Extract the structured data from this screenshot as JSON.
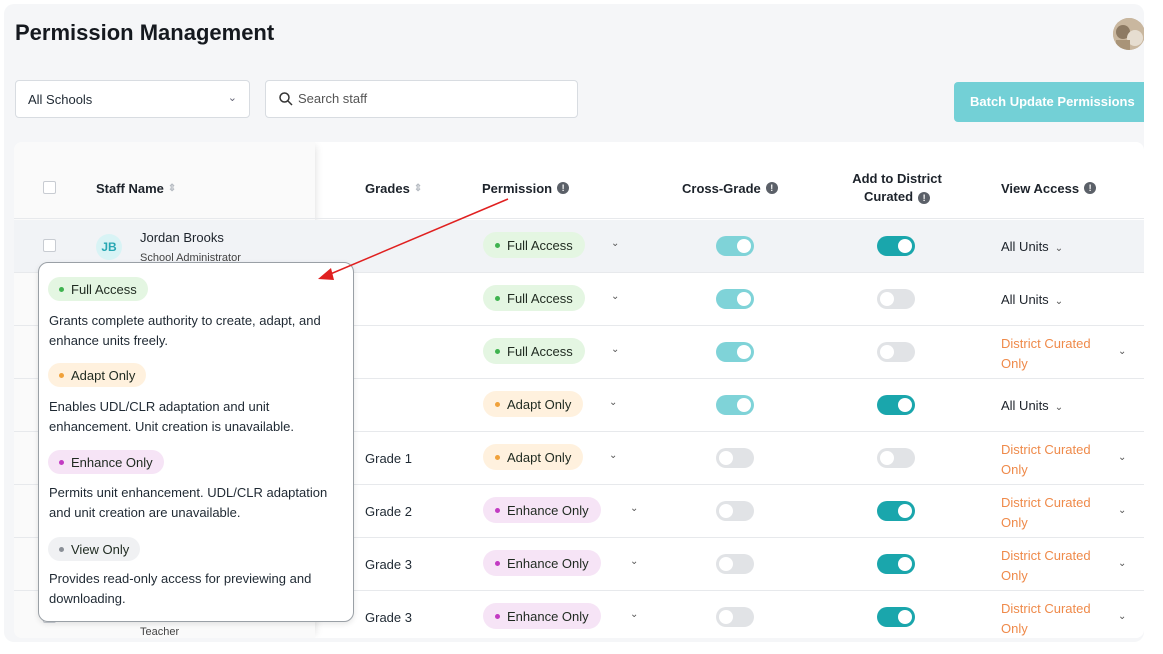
{
  "header": {
    "title": "Permission Management"
  },
  "filters": {
    "school_select": "All Schools",
    "search_placeholder": "Search staff",
    "batch_button": "Batch Update Permissions"
  },
  "table": {
    "columns": {
      "staff_name": "Staff Name",
      "grades": "Grades",
      "permission": "Permission",
      "cross_grade": "Cross-Grade",
      "add_to_district_line1": "Add to District",
      "add_to_district_line2": "Curated",
      "view_access": "View Access"
    },
    "rows": [
      {
        "initials": "JB",
        "name": "Jordan Brooks",
        "role": "School Administrator",
        "grade": "",
        "permission": "Full Access",
        "cross_grade": "on-light",
        "district": "on",
        "view_access": "All Units"
      },
      {
        "initials": "",
        "name": "",
        "role": "",
        "grade": "",
        "permission": "Full Access",
        "cross_grade": "on-light",
        "district": "off",
        "view_access": "All Units"
      },
      {
        "initials": "",
        "name": "",
        "role": "",
        "grade": "",
        "permission": "Full Access",
        "cross_grade": "on-light",
        "district": "off",
        "view_access": "District Curated Only"
      },
      {
        "initials": "",
        "name": "",
        "role": "",
        "grade": "",
        "permission": "Adapt Only",
        "cross_grade": "on-light",
        "district": "on",
        "view_access": "All Units"
      },
      {
        "initials": "",
        "name": "",
        "role": "",
        "grade": "Grade 1",
        "permission": "Adapt Only",
        "cross_grade": "off",
        "district": "off",
        "view_access": "District Curated Only"
      },
      {
        "initials": "",
        "name": "",
        "role": "",
        "grade": "Grade 2",
        "permission": "Enhance Only",
        "cross_grade": "off",
        "district": "on",
        "view_access": "District Curated Only"
      },
      {
        "initials": "",
        "name": "",
        "role": "",
        "grade": "Grade 3",
        "permission": "Enhance Only",
        "cross_grade": "off",
        "district": "on",
        "view_access": "District Curated Only"
      },
      {
        "initials": "",
        "name": "",
        "role": "Teacher",
        "grade": "Grade 3",
        "permission": "Enhance Only",
        "cross_grade": "off",
        "district": "on",
        "view_access": "District Curated Only"
      }
    ]
  },
  "popover": {
    "items": [
      {
        "label": "Full Access",
        "description": "Grants complete authority to create, adapt, and enhance units freely."
      },
      {
        "label": "Adapt Only",
        "description": "Enables UDL/CLR adaptation and unit enhancement. Unit creation is unavailable."
      },
      {
        "label": "Enhance Only",
        "description": "Permits unit enhancement. UDL/CLR adaptation and unit creation are unavailable."
      },
      {
        "label": "View Only",
        "description": "Provides read-only access for previewing and downloading."
      }
    ]
  },
  "colors": {
    "accent_teal": "#1aa6ac",
    "accent_teal_light": "#7fd3d8",
    "orange_text": "#ef8a4a",
    "annotation_arrow": "#e02020"
  },
  "icons": [
    "chevron-down-icon",
    "search-icon",
    "sort-icon",
    "info-icon",
    "avatar"
  ]
}
